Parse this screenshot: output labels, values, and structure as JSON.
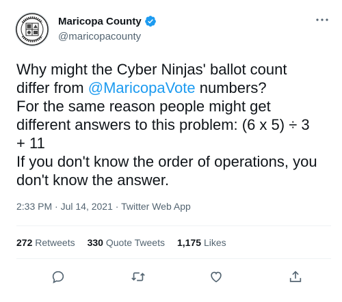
{
  "account": {
    "name": "Maricopa County",
    "handle": "@maricopacounty",
    "avatar_icon": "maricopa-county-seal",
    "verified": true
  },
  "tweet": {
    "lines": [
      {
        "parts": [
          "Why might the Cyber Ninjas' ballot count"
        ]
      },
      {
        "parts": [
          "differ from ",
          "@MaricopaVote",
          " numbers?"
        ]
      },
      {
        "parts": [
          "For the same reason people might get"
        ]
      },
      {
        "parts": [
          "different answers to this problem: (6 x 5) ÷  3"
        ]
      },
      {
        "parts": [
          "+ 11"
        ]
      },
      {
        "parts": [
          "If you don't know the order of operations, you"
        ]
      },
      {
        "parts": [
          "don't know the answer."
        ]
      }
    ]
  },
  "meta": {
    "time": "2:33 PM",
    "sep1": " · ",
    "date": "Jul 14, 2021",
    "sep2": " · ",
    "source": "Twitter Web App"
  },
  "stats": {
    "retweets_count": "272",
    "retweets_label": "Retweets",
    "quotes_count": "330",
    "quotes_label": "Quote Tweets",
    "likes_count": "1,175",
    "likes_label": "Likes"
  },
  "colors": {
    "accent": "#1d9bf0",
    "text": "#0f1419",
    "secondary": "#536471"
  }
}
